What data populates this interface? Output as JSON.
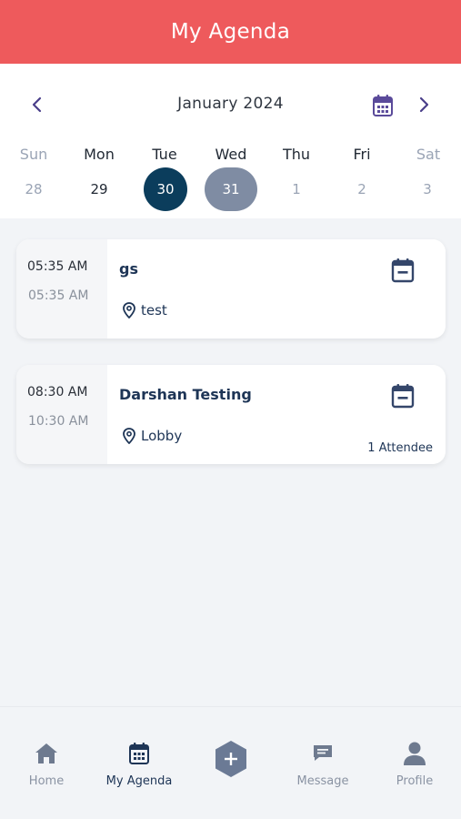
{
  "header": {
    "title": "My Agenda"
  },
  "calendar": {
    "month": "January 2024",
    "days": [
      {
        "name": "Sun",
        "num": "28"
      },
      {
        "name": "Mon",
        "num": "29"
      },
      {
        "name": "Tue",
        "num": "30"
      },
      {
        "name": "Wed",
        "num": "31"
      },
      {
        "name": "Thu",
        "num": "1"
      },
      {
        "name": "Fri",
        "num": "2"
      },
      {
        "name": "Sat",
        "num": "3"
      }
    ]
  },
  "events": [
    {
      "start": "05:35 AM",
      "end": "05:35 AM",
      "title": "gs",
      "location": "test",
      "attendees": ""
    },
    {
      "start": "08:30 AM",
      "end": "10:30 AM",
      "title": "Darshan Testing",
      "location": "Lobby",
      "attendees": "1 Attendee"
    }
  ],
  "tabs": {
    "home": "Home",
    "agenda": "My Agenda",
    "message": "Message",
    "profile": "Profile"
  },
  "colors": {
    "header": "#ee5a5c",
    "selected_day": "#0b3d5c",
    "today": "#7f8ca3",
    "accent": "#1e3556"
  }
}
